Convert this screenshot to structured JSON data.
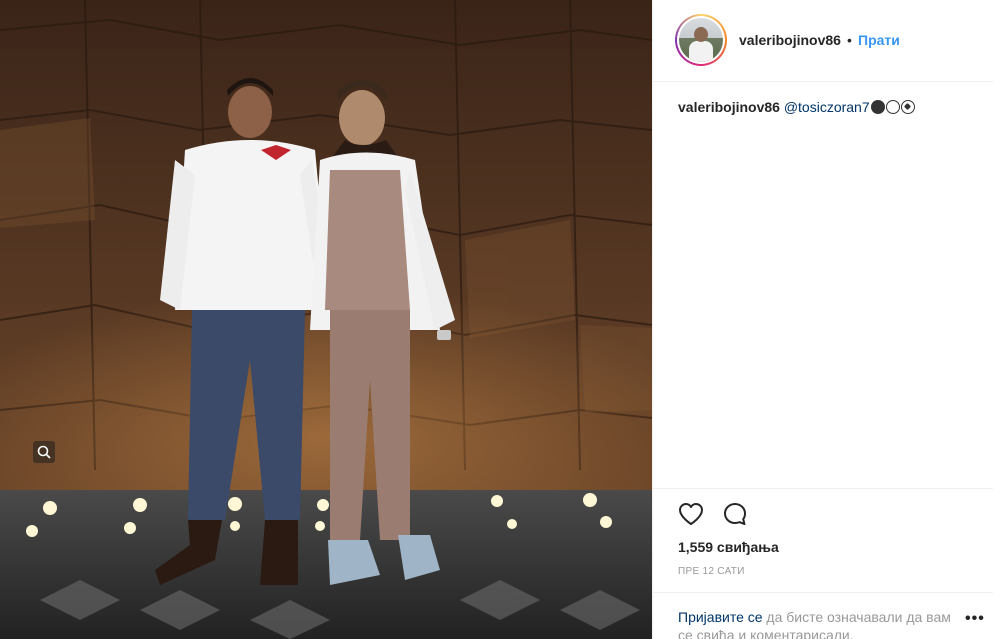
{
  "post": {
    "username": "valeribojinov86",
    "separator": "•",
    "follow_label": "Прати",
    "caption": {
      "username": "valeribojinov86",
      "mention": "@tosiczoran7",
      "emojis": [
        "black-circle-icon",
        "white-circle-icon",
        "soccer-ball-icon"
      ]
    },
    "likes": "1,559 свиђања",
    "time_ago": "ПРЕ 12 САТИ",
    "login_prompt": {
      "link": "Пријавите се",
      "text": " да бисте означавали да вам се свиђа и коментарисали."
    },
    "more_label": "•••"
  },
  "colors": {
    "link_blue": "#3897f0",
    "mention_dark_blue": "#003569",
    "muted_gray": "#999999",
    "border": "#efefef"
  }
}
